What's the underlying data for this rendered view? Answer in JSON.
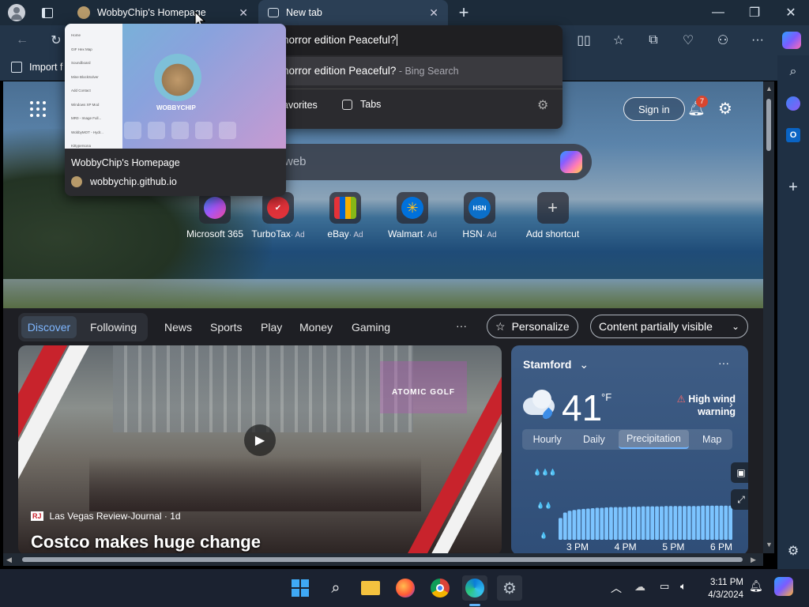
{
  "browser": {
    "tabs": [
      {
        "title": "WobbyChip's Homepage",
        "active": false
      },
      {
        "title": "New tab",
        "active": true
      }
    ],
    "favorites_bar": {
      "import_label": "Import f"
    },
    "omnibox": {
      "query": "horror edition Peaceful?",
      "suggestion_text": "horror edition Peaceful?",
      "suggestion_source": " - Bing Search",
      "filters": [
        "avorites",
        "Tabs"
      ]
    },
    "hover_card": {
      "title": "WobbyChip's Homepage",
      "url": "wobbychip.github.io",
      "preview_name": "WOBBYCHIP",
      "preview_menu": [
        "Home",
        "GIF Hex Map",
        "Soundboard",
        "Mine BlockSolver",
        "Add Contact",
        "Windows XP Mod",
        "MR0 - Image Full...",
        "WobbyMOT - Hydr...",
        "Kittypersona"
      ]
    }
  },
  "newtab": {
    "sign_in": "Sign in",
    "notifications_count": "7",
    "search_placeholder": "web",
    "shortcuts": [
      {
        "name": "Microsoft 365",
        "ad": "",
        "color": "#5a4bd6"
      },
      {
        "name": "TurboTax",
        "ad": "· Ad",
        "color": "#e0323a"
      },
      {
        "name": "eBay",
        "ad": "· Ad",
        "color": "#f5c518"
      },
      {
        "name": "Walmart",
        "ad": "· Ad",
        "color": "#0071dc"
      },
      {
        "name": "HSN",
        "ad": "· Ad",
        "color": "#0b6fc9"
      },
      {
        "name": "Add shortcut",
        "ad": "",
        "color": "#555"
      }
    ],
    "feed_nav": {
      "tabs": [
        "Discover",
        "Following"
      ],
      "items": [
        "News",
        "Sports",
        "Play",
        "Money",
        "Gaming"
      ],
      "more": "···",
      "personalize": "Personalize",
      "content_visibility": "Content partially visible"
    },
    "news_card": {
      "source_badge": "RJ",
      "source": "Las Vegas Review-Journal · 1d",
      "headline": "Costco makes huge change",
      "sign_text": "ATOMIC GOLF"
    },
    "weather": {
      "location": "Stamford",
      "temperature": "41",
      "unit": "°F",
      "alert": "High wind warning",
      "tabs": [
        "Hourly",
        "Daily",
        "Precipitation",
        "Map"
      ],
      "selected_tab": "Precipitation",
      "time_labels": [
        "3 PM",
        "4 PM",
        "5 PM",
        "6 PM"
      ],
      "precip_levels": [
        "💧💧💧",
        "💧💧",
        "💧"
      ]
    }
  },
  "taskbar": {
    "time": "3:11 PM",
    "date": "4/3/2024"
  },
  "chart_data": {
    "type": "bar",
    "title": "",
    "xlabel": "",
    "ylabel": "",
    "categories": [
      "3 PM",
      "4 PM",
      "5 PM",
      "6 PM"
    ],
    "values": [
      0.6,
      0.75,
      0.8,
      0.82,
      0.84,
      0.85,
      0.86,
      0.87,
      0.88,
      0.88,
      0.89,
      0.9,
      0.9,
      0.9,
      0.9,
      0.91,
      0.91,
      0.91,
      0.92,
      0.92,
      0.92,
      0.92,
      0.92,
      0.93,
      0.93,
      0.93,
      0.93,
      0.93,
      0.93,
      0.93,
      0.93,
      0.94,
      0.94,
      0.94,
      0.94,
      0.94,
      0.94,
      0.94
    ]
  }
}
